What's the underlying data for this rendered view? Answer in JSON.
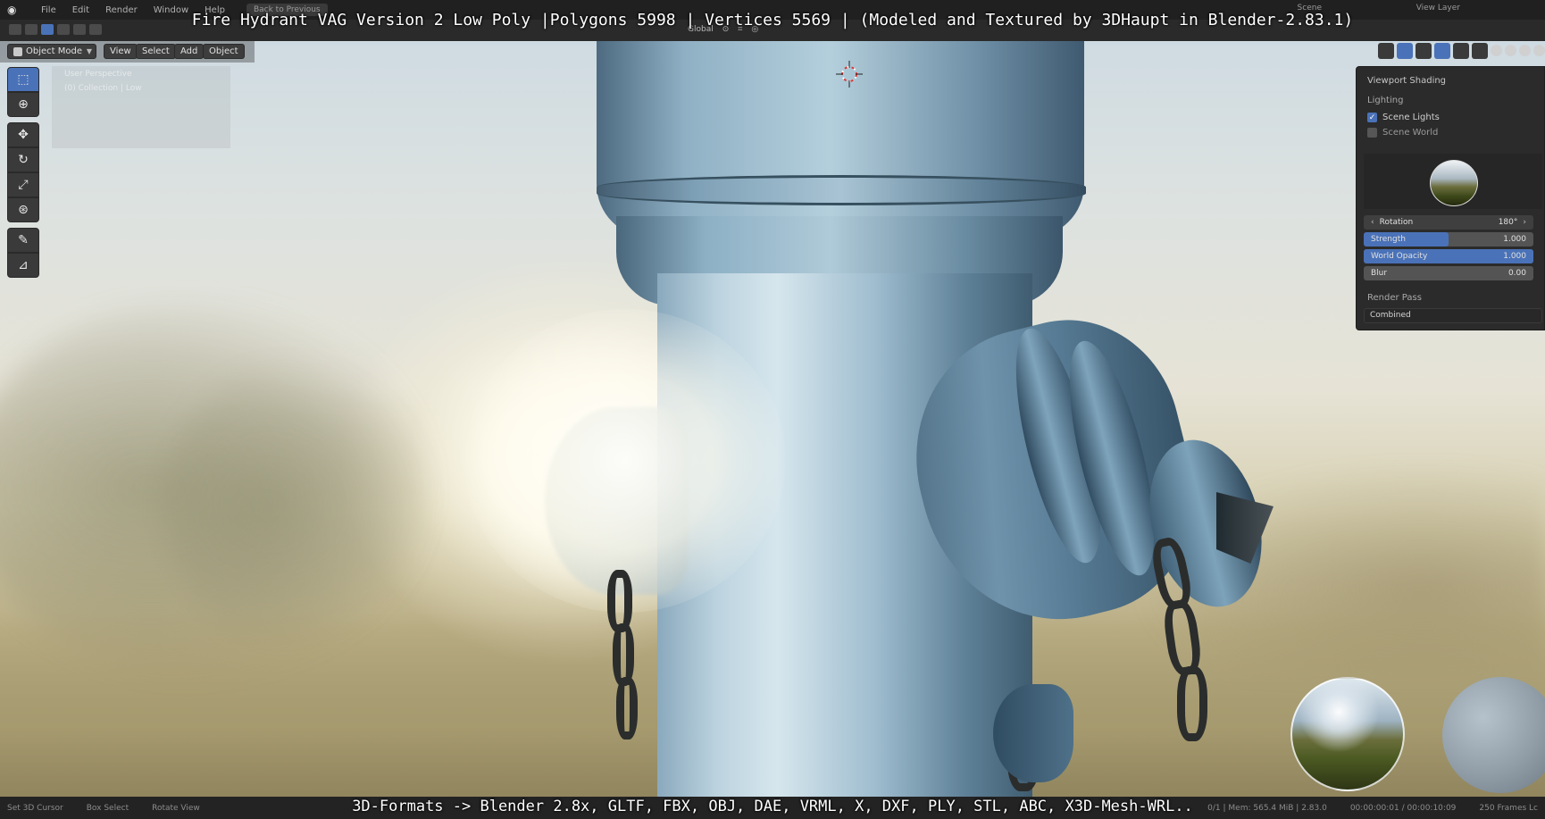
{
  "overlay": {
    "title": "Fire Hydrant VAG Version 2 Low Poly |Polygons 5998 | Vertices 5569 | (Modeled and Textured by 3DHaupt in Blender-2.83.1)",
    "footer": "3D-Formats -> Blender 2.8x, GLTF, FBX, OBJ, DAE, VRML, X, DXF, PLY, STL, ABC, X3D-Mesh-WRL.."
  },
  "menubar": {
    "items": [
      "File",
      "Edit",
      "Render",
      "Window",
      "Help"
    ],
    "back_label": "Back to Previous",
    "scene_label": "Scene",
    "view_layer_label": "View Layer"
  },
  "toolbar": {
    "orientation": "Global"
  },
  "header": {
    "mode": "Object Mode",
    "buttons": [
      "View",
      "Select",
      "Add",
      "Object"
    ]
  },
  "viewport": {
    "info_line1": "User Perspective",
    "info_line2": "(0) Collection | Low"
  },
  "tools": [
    "select-box",
    "cursor",
    "move",
    "rotate",
    "scale",
    "transform",
    "annotate",
    "measure"
  ],
  "shading_panel": {
    "title": "Viewport Shading",
    "lighting_label": "Lighting",
    "scene_lights_label": "Scene Lights",
    "scene_lights_checked": true,
    "scene_world_label": "Scene World",
    "scene_world_checked": false,
    "rotation_label": "Rotation",
    "rotation_value": "180°",
    "strength_label": "Strength",
    "strength_value": "1.000",
    "strength_fraction": 0.5,
    "world_opacity_label": "World Opacity",
    "world_opacity_value": "1.000",
    "world_opacity_fraction": 1.0,
    "blur_label": "Blur",
    "blur_value": "0.00",
    "render_pass_label": "Render Pass",
    "render_pass_value": "Combined"
  },
  "statusbar": {
    "left": [
      "Set 3D Cursor",
      "Box Select",
      "Rotate View"
    ],
    "right": [
      "0/1 | Mem: 565.4 MiB | 2.83.0",
      "00:00:00:01 / 00:00:10:09",
      "250 Frames Lc"
    ]
  },
  "colors": {
    "accent": "#4a72b8",
    "panel": "#2b2b2b",
    "hydrant": "#6f93ab"
  }
}
